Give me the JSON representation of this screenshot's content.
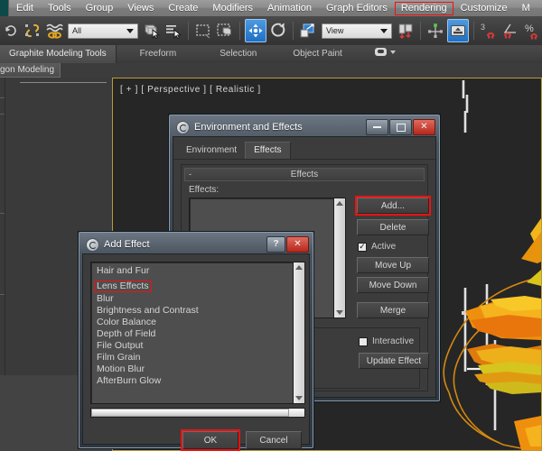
{
  "menubar": {
    "items": [
      {
        "label": "Edit",
        "highlighted": false
      },
      {
        "label": "Tools",
        "highlighted": false
      },
      {
        "label": "Group",
        "highlighted": false
      },
      {
        "label": "Views",
        "highlighted": false
      },
      {
        "label": "Create",
        "highlighted": false
      },
      {
        "label": "Modifiers",
        "highlighted": false
      },
      {
        "label": "Animation",
        "highlighted": false
      },
      {
        "label": "Graph Editors",
        "highlighted": false
      },
      {
        "label": "Rendering",
        "highlighted": true
      },
      {
        "label": "Customize",
        "highlighted": false
      },
      {
        "label": "M",
        "highlighted": false
      }
    ]
  },
  "toolbar": {
    "selection_filter_value": "All",
    "reference_coord_value": "View",
    "axis_constraint_count": "3",
    "icons": [
      "undo-icon",
      "redo-icon",
      "select-link-icon",
      "unlink-icon",
      "bind-spacewarp-icon",
      "select-object-icon",
      "select-by-name-icon",
      "rectangle-selection-region-icon",
      "window-crossing-icon",
      "select-and-move-icon",
      "select-and-rotate-icon",
      "select-and-scale-icon",
      "mirror-icon",
      "align-icon",
      "manipulate-icon",
      "snaps-toggle-icon",
      "angle-snap-toggle-icon",
      "percent-snap-toggle-icon",
      "spinner-snap-toggle-icon",
      "named-selection-icon"
    ]
  },
  "ribbon": {
    "tabs": [
      {
        "label": "Graphite Modeling Tools",
        "selected": true
      },
      {
        "label": "Freeform",
        "selected": false
      },
      {
        "label": "Selection",
        "selected": false
      },
      {
        "label": "Object Paint",
        "selected": false
      }
    ],
    "panel_label": "ygon Modeling",
    "overflow_icon": "ribbon-dropdown-icon"
  },
  "viewport": {
    "label": "[ + ] [ Perspective ] [ Realistic ]",
    "border_color": "#b89a3c",
    "background": "#262626",
    "artwork": {
      "flame_colors": [
        "#e8960f",
        "#f5b31e",
        "#d9d320",
        "#ef7d10"
      ],
      "curve_color": "#d4880f",
      "gizmo_color": "#e8e8e8"
    }
  },
  "environment_dialog": {
    "title": "Environment and Effects",
    "icon": "max-window-icon",
    "window_buttons": [
      {
        "name": "minimize",
        "glyph": "minimize-icon"
      },
      {
        "name": "maximize",
        "glyph": "maximize-icon"
      },
      {
        "name": "close",
        "glyph": "close-icon"
      }
    ],
    "tabs": [
      {
        "label": "Environment",
        "selected": false
      },
      {
        "label": "Effects",
        "selected": true
      }
    ],
    "rollout": {
      "title": "Effects",
      "collapse_glyph": "-"
    },
    "effects_label": "Effects:",
    "effects_list": [],
    "buttons": [
      {
        "label": "Add...",
        "highlighted": true,
        "name": "add-effect-button"
      },
      {
        "label": "Delete",
        "highlighted": false,
        "name": "delete-effect-button"
      },
      {
        "label": "Move Up",
        "highlighted": false,
        "name": "move-up-button"
      },
      {
        "label": "Move Down",
        "highlighted": false,
        "name": "move-down-button"
      },
      {
        "label": "Merge",
        "highlighted": false,
        "name": "merge-button"
      }
    ],
    "active_checkbox": {
      "label": "Active",
      "checked": true
    },
    "interactive_checkbox": {
      "label": "Interactive",
      "checked": false
    },
    "update_effect_label": "Update Effect"
  },
  "add_effect_dialog": {
    "title": "Add Effect",
    "icon": "max-window-icon",
    "help_button": "?",
    "close_button": "close-icon",
    "items": [
      {
        "label": "Hair and Fur",
        "highlighted": false
      },
      {
        "label": "Lens Effects",
        "highlighted": true
      },
      {
        "label": "Blur",
        "highlighted": false
      },
      {
        "label": "Brightness and Contrast",
        "highlighted": false
      },
      {
        "label": "Color Balance",
        "highlighted": false
      },
      {
        "label": "Depth of Field",
        "highlighted": false
      },
      {
        "label": "File Output",
        "highlighted": false
      },
      {
        "label": "Film Grain",
        "highlighted": false
      },
      {
        "label": "Motion Blur",
        "highlighted": false
      },
      {
        "label": "AfterBurn Glow",
        "highlighted": false
      }
    ],
    "ok_label": "OK",
    "ok_highlighted": true,
    "cancel_label": "Cancel"
  },
  "colors": {
    "highlight_red": "#ee1111",
    "dialog_blue_gray": "#4a545e",
    "panel_gray": "#3c3c3c",
    "accent_blue": "#2f7fd0"
  }
}
